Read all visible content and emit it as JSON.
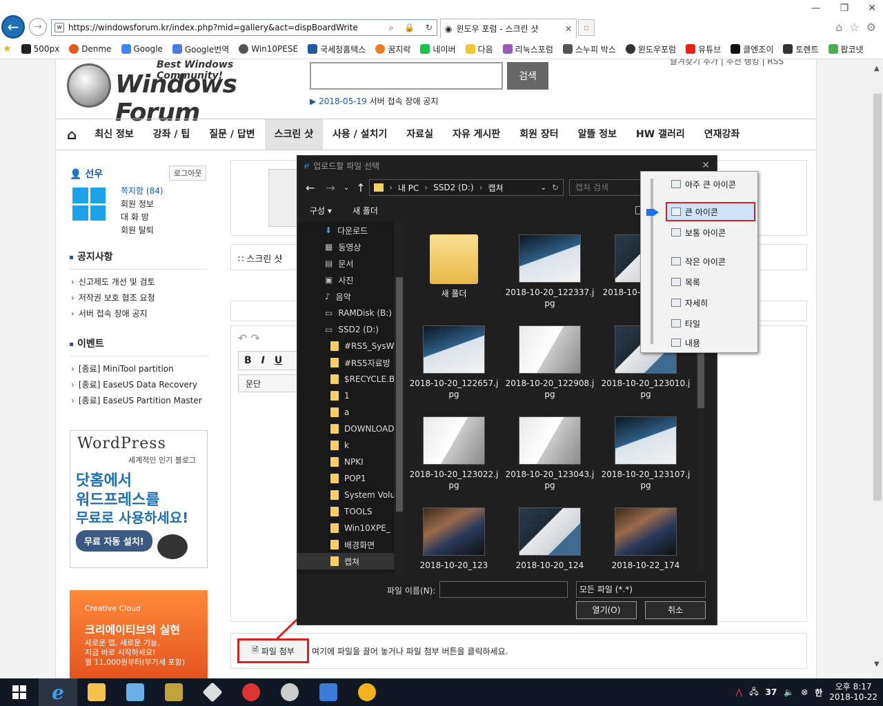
{
  "browser": {
    "url": "https://windowsforum.kr/index.php?mid=gallery&act=dispBoardWrite",
    "tab_title": "윈도우 포럼 - 스크린 샷",
    "favorites": [
      "500px",
      "Denme",
      "Google",
      "Google번역",
      "Win10PESE",
      "국세청홈택스",
      "꿈지락",
      "네이버",
      "다음",
      "리눅스포럼",
      "스누피 박스",
      "윈도우포럼",
      "유튜브",
      "클엔조이",
      "토렌트",
      "팝코넷"
    ]
  },
  "site": {
    "tagline": "Best Windows Community!",
    "logo_text": "Windows Forum",
    "search_button": "검색",
    "notice_date": "2018-05-19",
    "notice_text": "서버 접속 장애 공지",
    "top_links": "즐겨찾기 추가 | 추천 랭킹 | RSS",
    "nav": [
      "최신 정보",
      "강좌 / 팁",
      "질문 / 답변",
      "스크린 샷",
      "사용 / 설치기",
      "자료실",
      "자유 게시판",
      "회원 장터",
      "알뜰 정보",
      "HW 갤러리",
      "연재강좌"
    ]
  },
  "sidebar": {
    "user_name": "선우",
    "logout": "로그아웃",
    "user_links": [
      "쪽지함 (84)",
      "회원 정보",
      "대 화 방",
      "회원 탈퇴"
    ],
    "notice_title": "공지사항",
    "notices": [
      "신고제도 개선 및 검토",
      "저작권 보호 협조 요청",
      "서버 접속 장애 공지"
    ],
    "event_title": "이벤트",
    "events": [
      "[종료] MiniTool partition",
      "[종료] EaseUS Data Recovery",
      "[종료] EaseUS Partition Master"
    ],
    "ad_wp_brand": "WordPress",
    "ad_wp_sub": "세계적인 인기 블로그",
    "ad_wp_line1": "닷홈에서",
    "ad_wp_line2": "워드프레스를",
    "ad_wp_line3": "무료로 사용하세요!",
    "ad_wp_btn": "무료 자동 설치!",
    "ad_cc_brand": "Creative Cloud",
    "ad_cc_title": "크리에이티브의 실현",
    "ad_cc_sub1": "새로운 앱, 새로운 기능,",
    "ad_cc_sub2": "지금 바로 시작하세요!",
    "ad_cc_price": "월 11,000원부터(부가세 포함)"
  },
  "editor": {
    "category_label": "스크린 샷",
    "paragraph_select": "문단",
    "attach_button": "파일 첨부",
    "attach_hint": "여기에 파일을 끌어 놓거나 파일 첨부 버튼을 클릭하세요."
  },
  "dialog": {
    "title": "업로드할 파일 선택",
    "path": [
      "내 PC",
      "SSD2 (D:)",
      "캡쳐"
    ],
    "search_placeholder": "캡쳐 검색",
    "organize": "구성",
    "new_folder": "새 폴더",
    "tree": [
      {
        "label": "다운로드",
        "kind": "download"
      },
      {
        "label": "동영상",
        "kind": "video"
      },
      {
        "label": "문서",
        "kind": "doc"
      },
      {
        "label": "사진",
        "kind": "pic"
      },
      {
        "label": "음악",
        "kind": "music"
      },
      {
        "label": "RAMDisk (B:)",
        "kind": "drive"
      },
      {
        "label": "SSD2 (D:)",
        "kind": "drive"
      },
      {
        "label": "#RS5_SysWO",
        "kind": "folder"
      },
      {
        "label": "#RS5자료방",
        "kind": "folder"
      },
      {
        "label": "$RECYCLE.BII",
        "kind": "folder"
      },
      {
        "label": "1",
        "kind": "folder"
      },
      {
        "label": "a",
        "kind": "folder"
      },
      {
        "label": "DOWNLOAD",
        "kind": "folder"
      },
      {
        "label": "k",
        "kind": "folder"
      },
      {
        "label": "NPKI",
        "kind": "folder"
      },
      {
        "label": "POP1",
        "kind": "folder"
      },
      {
        "label": "System Volu",
        "kind": "folder"
      },
      {
        "label": "TOOLS",
        "kind": "folder"
      },
      {
        "label": "Win10XPE_",
        "kind": "folder"
      },
      {
        "label": "배경화면",
        "kind": "folder"
      },
      {
        "label": "캡쳐",
        "kind": "folder",
        "selected": true
      }
    ],
    "files": [
      {
        "name": "새 폴더",
        "type": "folder"
      },
      {
        "name": "2018-10-20_122337.jpg"
      },
      {
        "name": "2018-10-20_12...60.jpg"
      },
      {
        "name": "2018-10-20_122657.jpg"
      },
      {
        "name": "2018-10-20_122908.jpg"
      },
      {
        "name": "2018-10-20_123010.jpg"
      },
      {
        "name": "2018-10-20_123022.jpg"
      },
      {
        "name": "2018-10-20_123043.jpg"
      },
      {
        "name": "2018-10-20_123107.jpg"
      },
      {
        "name": "2018-10-20_123"
      },
      {
        "name": "2018-10-20_124"
      },
      {
        "name": "2018-10-22_174"
      }
    ],
    "filename_label": "파일 이름(N):",
    "filter": "모든 파일 (*.*)",
    "open_button": "열기(O)",
    "cancel_button": "취소"
  },
  "view_menu": {
    "items": [
      {
        "label": "아주 큰 아이콘"
      },
      {
        "label": "큰 아이콘",
        "selected": true
      },
      {
        "label": "보통 아이콘"
      },
      {
        "label": "작은 아이콘"
      },
      {
        "label": "목록"
      },
      {
        "label": "자세히"
      },
      {
        "label": "타일"
      },
      {
        "label": "내용"
      }
    ]
  },
  "taskbar": {
    "time": "오후 8:17",
    "date": "2018-10-22",
    "temp": "37",
    "ime": "한"
  }
}
